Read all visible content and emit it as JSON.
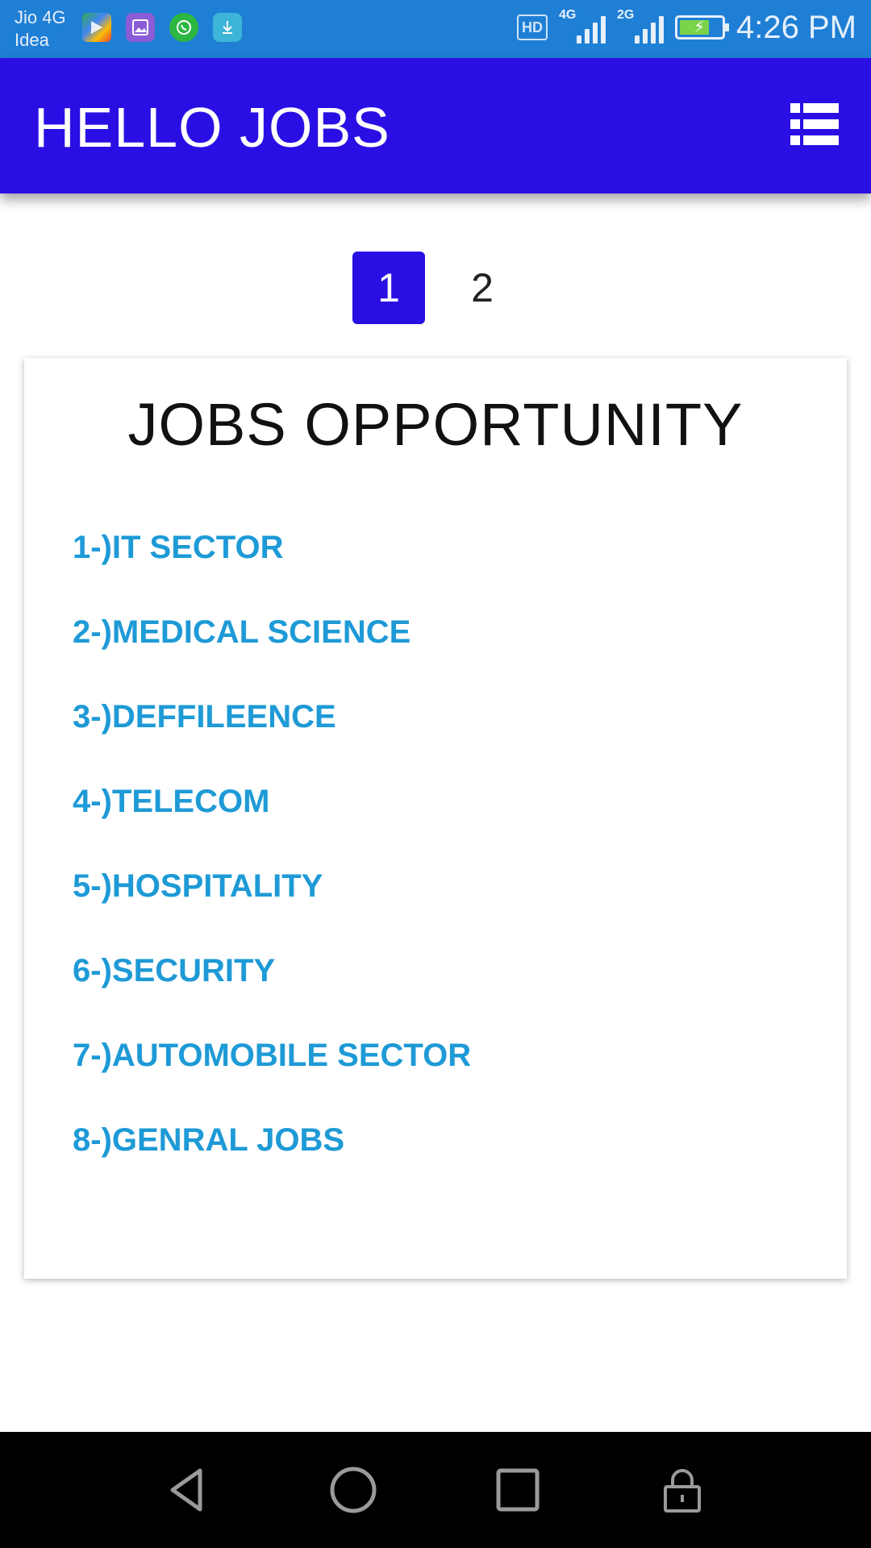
{
  "status_bar": {
    "carrier_line1": "Jio 4G",
    "carrier_line2": "Idea",
    "notification_icons": [
      "games-icon",
      "gallery-icon",
      "whatsapp-icon",
      "download-icon"
    ],
    "hd_label": "HD",
    "sim1_network": "4G",
    "sim2_network": "2G",
    "time": "4:26 PM",
    "background_color": "#1f7fd5"
  },
  "app_bar": {
    "title": "HELLO JOBS",
    "menu_icon": "list-icon",
    "background_color": "#2a0fe4"
  },
  "pagination": {
    "pages": [
      "1",
      "2"
    ],
    "active_page": "1"
  },
  "card": {
    "title": "JOBS OPPORTUNITY",
    "items": [
      "1-)IT SECTOR",
      "2-)MEDICAL SCIENCE",
      "3-)DEFFILEENCE",
      "4-)TELECOM",
      "5-)HOSPITALITY",
      "6-)SECURITY",
      "7-)AUTOMOBILE SECTOR",
      "8-)GENRAL JOBS"
    ],
    "link_color": "#1e9ad6"
  },
  "nav_bar": {
    "buttons": [
      "back-icon",
      "home-icon",
      "recents-icon",
      "lock-icon"
    ]
  }
}
